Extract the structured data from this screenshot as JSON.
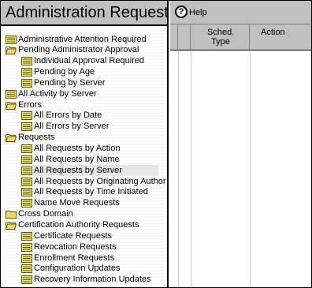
{
  "left": {
    "title": "Administration Requests",
    "tree": [
      {
        "label": "Administrative Attention Required",
        "icon": "view-icon",
        "level": 0
      },
      {
        "label": "Pending Administrator Approval",
        "icon": "folder-open-icon",
        "level": 0
      },
      {
        "label": "Individual Approval Required",
        "icon": "view-icon",
        "level": 1
      },
      {
        "label": "Pending by Age",
        "icon": "view-icon",
        "level": 1
      },
      {
        "label": "Pending by Server",
        "icon": "view-icon",
        "level": 1
      },
      {
        "label": "All Activity by Server",
        "icon": "view-icon",
        "level": 0
      },
      {
        "label": "Errors",
        "icon": "folder-open-icon",
        "level": 0
      },
      {
        "label": "All Errors by Date",
        "icon": "view-icon",
        "level": 1
      },
      {
        "label": "All Errors by Server",
        "icon": "view-icon",
        "level": 1
      },
      {
        "label": "Requests",
        "icon": "folder-open-icon",
        "level": 0
      },
      {
        "label": "All Requests by Action",
        "icon": "view-icon",
        "level": 1
      },
      {
        "label": "All Requests by Name",
        "icon": "view-icon",
        "level": 1
      },
      {
        "label": "All Requests by Server",
        "icon": "view-icon",
        "level": 1,
        "selected": true
      },
      {
        "label": "All Requests by Originating Author",
        "icon": "view-icon",
        "level": 1
      },
      {
        "label": "All Requests by Time Initiated",
        "icon": "view-icon",
        "level": 1
      },
      {
        "label": "Name Move Requests",
        "icon": "view-icon",
        "level": 1
      },
      {
        "label": "Cross Domain",
        "icon": "folder-closed-icon",
        "level": 0
      },
      {
        "label": "Certification Authority Requests",
        "icon": "folder-open-icon",
        "level": 0
      },
      {
        "label": "Certificate Requests",
        "icon": "view-icon",
        "level": 1
      },
      {
        "label": "Revocation Requests",
        "icon": "view-icon",
        "level": 1
      },
      {
        "label": "Enrollment Requests",
        "icon": "view-icon",
        "level": 1
      },
      {
        "label": "Configuration Updates",
        "icon": "view-icon",
        "level": 1
      },
      {
        "label": "Recovery Information Updates",
        "icon": "view-icon",
        "level": 1
      }
    ]
  },
  "right": {
    "help_label": "Help",
    "help_icon": "help-icon",
    "columns": [
      "",
      "",
      "Sched. Type",
      "Action"
    ]
  },
  "colors": {
    "header_bg": "#c0c0c0",
    "folder_yellow": "#f0d860",
    "view_icon_yellow": "#f2e37a"
  }
}
